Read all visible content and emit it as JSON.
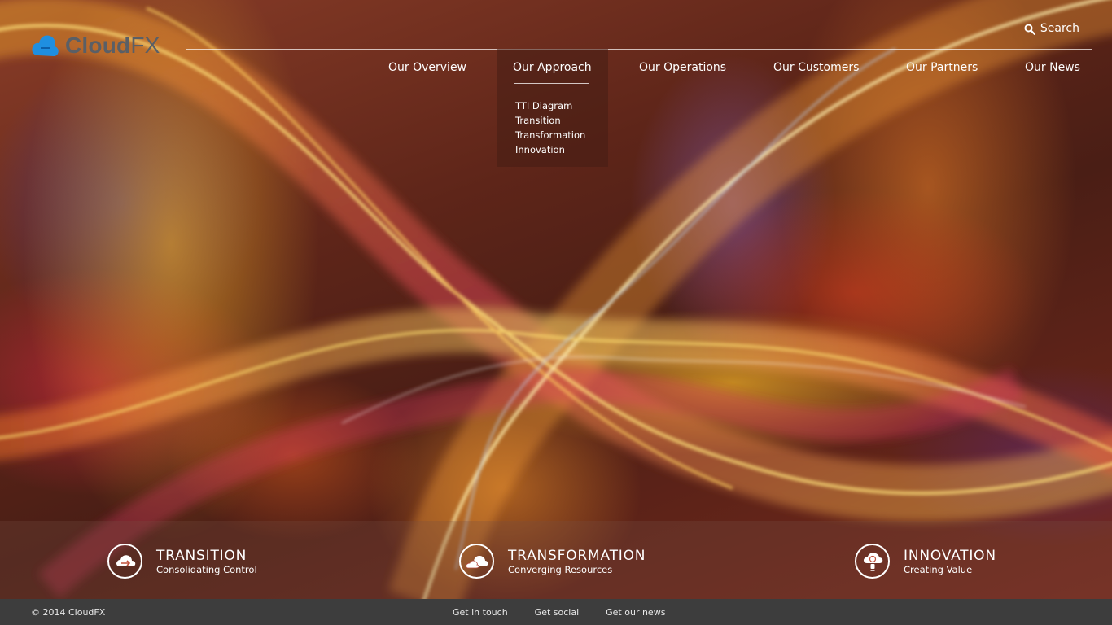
{
  "brand": {
    "logo_prefix": "Cloud",
    "logo_suffix": "FX",
    "logo_color": "#5a5f66",
    "accent": "#1f8fe0"
  },
  "search": {
    "label": "Search"
  },
  "nav": {
    "items": [
      {
        "label": "Our Overview"
      },
      {
        "label": "Our Approach"
      },
      {
        "label": "Our Operations"
      },
      {
        "label": "Our Customers"
      },
      {
        "label": "Our Partners"
      },
      {
        "label": "Our News"
      }
    ],
    "active_index": 1,
    "dropdown": {
      "items": [
        "TTI Diagram",
        "Transition",
        "Transformation",
        "Innovation"
      ]
    }
  },
  "features": [
    {
      "title": "TRANSITION",
      "subtitle": "Consolidating Control",
      "icon": "cloud-arrows-icon"
    },
    {
      "title": "TRANSFORMATION",
      "subtitle": "Converging Resources",
      "icon": "clouds-icon"
    },
    {
      "title": "INNOVATION",
      "subtitle": "Creating Value",
      "icon": "cloud-lightbulb-icon"
    }
  ],
  "footer": {
    "copyright": "© 2014 CloudFX",
    "links": [
      "Get in touch",
      "Get social",
      "Get our news"
    ],
    "background": "#3d3d3d"
  }
}
